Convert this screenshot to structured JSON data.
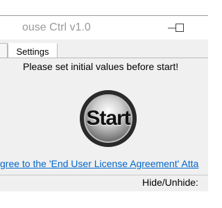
{
  "window": {
    "title": "ouse Ctrl v1.0"
  },
  "tabs": [
    {
      "label": ""
    },
    {
      "label": "Settings"
    }
  ],
  "main": {
    "instruction": "Please set initial values before start!",
    "start_label": "Start",
    "eula_text": "gree to the 'End User License Agreement' Atta",
    "hide_label": "Hide/Unhide:"
  },
  "colors": {
    "link": "#0066cc",
    "title_text": "#999999"
  }
}
